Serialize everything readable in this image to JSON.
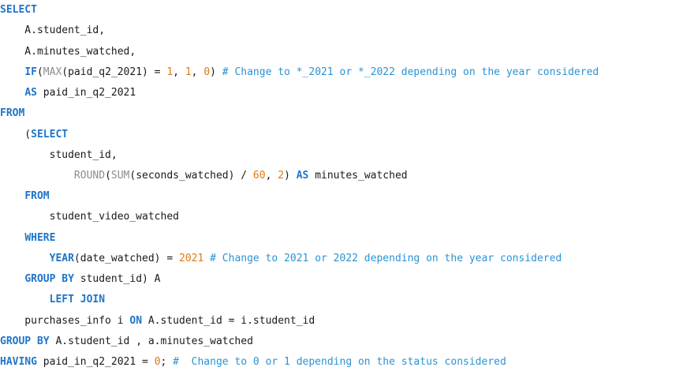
{
  "editor": {
    "lines": [
      [
        {
          "t": "SELECT",
          "c": "kw"
        }
      ],
      [
        {
          "t": "    A.student_id,",
          "c": "id"
        }
      ],
      [
        {
          "t": "    A.minutes_watched,",
          "c": "id"
        }
      ],
      [
        {
          "t": "    ",
          "c": "id"
        },
        {
          "t": "IF",
          "c": "kw"
        },
        {
          "t": "(",
          "c": "op"
        },
        {
          "t": "MAX",
          "c": "fn"
        },
        {
          "t": "(paid_q2_2021) = ",
          "c": "id"
        },
        {
          "t": "1",
          "c": "num"
        },
        {
          "t": ", ",
          "c": "op"
        },
        {
          "t": "1",
          "c": "num"
        },
        {
          "t": ", ",
          "c": "op"
        },
        {
          "t": "0",
          "c": "num"
        },
        {
          "t": ") ",
          "c": "op"
        },
        {
          "t": "# Change to *_2021 or *_2022 depending on the year considered",
          "c": "cm"
        }
      ],
      [
        {
          "t": "    ",
          "c": "id"
        },
        {
          "t": "AS",
          "c": "kw"
        },
        {
          "t": " paid_in_q2_2021",
          "c": "id"
        }
      ],
      [
        {
          "t": "FROM",
          "c": "kw"
        }
      ],
      [
        {
          "t": "    (",
          "c": "op"
        },
        {
          "t": "SELECT",
          "c": "kw"
        }
      ],
      [
        {
          "t": "        student_id,",
          "c": "id"
        }
      ],
      [
        {
          "t": "            ",
          "c": "id"
        },
        {
          "t": "ROUND",
          "c": "fn"
        },
        {
          "t": "(",
          "c": "op"
        },
        {
          "t": "SUM",
          "c": "fn"
        },
        {
          "t": "(seconds_watched) / ",
          "c": "id"
        },
        {
          "t": "60",
          "c": "num"
        },
        {
          "t": ", ",
          "c": "op"
        },
        {
          "t": "2",
          "c": "num"
        },
        {
          "t": ") ",
          "c": "op"
        },
        {
          "t": "AS",
          "c": "kw"
        },
        {
          "t": " minutes_watched",
          "c": "id"
        }
      ],
      [
        {
          "t": "    ",
          "c": "id"
        },
        {
          "t": "FROM",
          "c": "kw"
        }
      ],
      [
        {
          "t": "        student_video_watched",
          "c": "id"
        }
      ],
      [
        {
          "t": "    ",
          "c": "id"
        },
        {
          "t": "WHERE",
          "c": "kw"
        }
      ],
      [
        {
          "t": "        ",
          "c": "id"
        },
        {
          "t": "YEAR",
          "c": "kw"
        },
        {
          "t": "(date_watched) = ",
          "c": "id"
        },
        {
          "t": "2021",
          "c": "num"
        },
        {
          "t": " ",
          "c": "op"
        },
        {
          "t": "# Change to 2021 or 2022 depending on the year considered",
          "c": "cm"
        }
      ],
      [
        {
          "t": "    ",
          "c": "id"
        },
        {
          "t": "GROUP BY",
          "c": "kw"
        },
        {
          "t": " student_id) A",
          "c": "id"
        }
      ],
      [
        {
          "t": "        ",
          "c": "id"
        },
        {
          "t": "LEFT JOIN",
          "c": "kw"
        }
      ],
      [
        {
          "t": "    purchases_info i ",
          "c": "id"
        },
        {
          "t": "ON",
          "c": "kw"
        },
        {
          "t": " A.student_id = i.student_id",
          "c": "id"
        }
      ],
      [
        {
          "t": "GROUP BY",
          "c": "kw"
        },
        {
          "t": " A.student_id , a.minutes_watched",
          "c": "id"
        }
      ],
      [
        {
          "t": "HAVING",
          "c": "kw"
        },
        {
          "t": " paid_in_q2_2021 = ",
          "c": "id"
        },
        {
          "t": "0",
          "c": "num"
        },
        {
          "t": "; ",
          "c": "op"
        },
        {
          "t": "#  Change to 0 or 1 depending on the status considered",
          "c": "cm"
        }
      ]
    ]
  }
}
